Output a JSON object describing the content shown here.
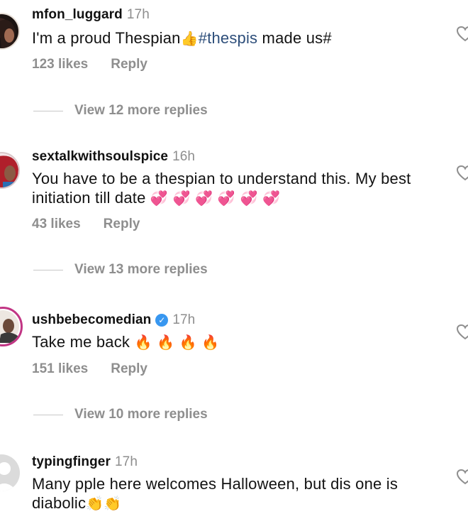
{
  "comments": [
    {
      "username": "mfon_luggard",
      "time": "17h",
      "text_before": "I'm a proud Thespian",
      "emoji_1": "👍",
      "hashtag": "#thespis",
      "text_after": " made us#",
      "likes": "123 likes",
      "reply": "Reply",
      "view_replies": "View 12 more replies"
    },
    {
      "username": "sextalkwithsoulspice",
      "time": "16h",
      "text": "You have to be a thespian to understand this. My best initiation till date",
      "emojis": "💞 💞 💞 💞 💞 💞",
      "likes": "43 likes",
      "reply": "Reply",
      "view_replies": "View 13 more replies"
    },
    {
      "username": "ushbebecomedian",
      "time": "17h",
      "verified_mark": "✓",
      "text": "Take me back",
      "emojis": "🔥 🔥 🔥 🔥",
      "likes": "151 likes",
      "reply": "Reply",
      "view_replies": "View 10 more replies"
    },
    {
      "username": "typingfinger",
      "time": "17h",
      "text": "Many pple here welcomes Halloween, but dis one is diabolic",
      "emojis": "👏👏"
    }
  ],
  "icons": {
    "like": "heart-outline-icon",
    "verified": "verified-badge-icon",
    "default_avatar": "default-avatar-icon"
  },
  "colors": {
    "background": "#ffffff",
    "text": "#121212",
    "muted": "#8e8e8e",
    "hashtag": "#2d4e7a",
    "verified": "#3897f0",
    "story_ring": "#c13584"
  }
}
